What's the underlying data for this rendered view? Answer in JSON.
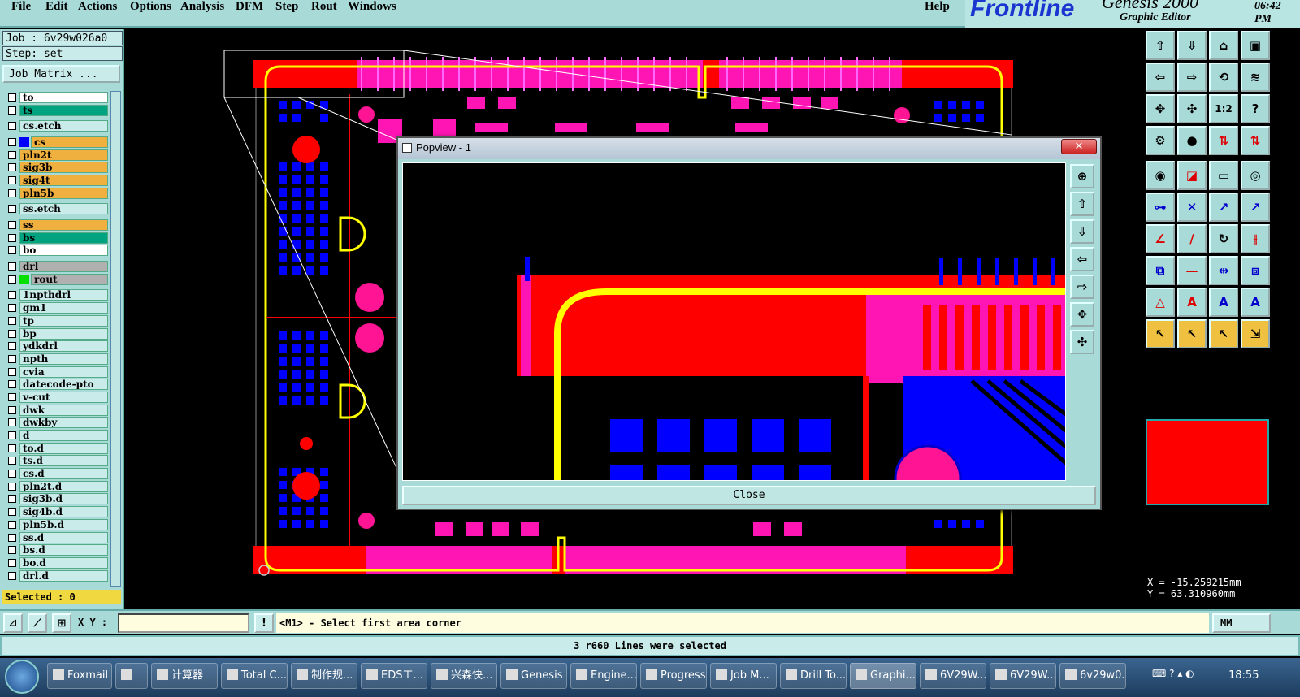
{
  "menubar": {
    "items": [
      "File",
      "Edit",
      "Actions",
      "Options",
      "Analysis",
      "DFM",
      "Step",
      "Rout",
      "Windows"
    ],
    "help": "Help"
  },
  "brand": {
    "logo": "Frontline",
    "product": "Genesis 2000",
    "subtitle": "Graphic Editor",
    "time": "06:42 PM"
  },
  "left": {
    "job": "Job :  6v29w026a0",
    "step": "Step:  set",
    "job_matrix": "Job Matrix ...",
    "layers": [
      {
        "name": "to",
        "color": "#ffffff"
      },
      {
        "name": "ts",
        "color": "#00a37f",
        "active": true
      },
      {
        "gap": true
      },
      {
        "name": "cs.etch",
        "color": "#c9ecea"
      },
      {
        "gap": true
      },
      {
        "name": "cs",
        "color": "#f0b040",
        "swatch": "#0000ff"
      },
      {
        "name": "pln2t",
        "color": "#f0b040"
      },
      {
        "name": "sig3b",
        "color": "#f0b040"
      },
      {
        "name": "sig4t",
        "color": "#f0b040"
      },
      {
        "name": "pln5b",
        "color": "#f0b040"
      },
      {
        "gap": true
      },
      {
        "name": "ss.etch",
        "color": "#c9ecea"
      },
      {
        "gap": true
      },
      {
        "name": "ss",
        "color": "#f0b040"
      },
      {
        "name": "bs",
        "color": "#00a37f"
      },
      {
        "name": "bo",
        "color": "#ffffff"
      },
      {
        "gap": true
      },
      {
        "name": "drl",
        "color": "#b0b0b0"
      },
      {
        "name": "rout",
        "color": "#b0b0b0",
        "swatch": "#00e000"
      },
      {
        "gap": true
      },
      {
        "name": "1npthdrl",
        "color": "#c9ecea"
      },
      {
        "name": "gm1",
        "color": "#c9ecea"
      },
      {
        "name": "tp",
        "color": "#c9ecea"
      },
      {
        "name": "bp",
        "color": "#c9ecea"
      },
      {
        "name": "ydkdrl",
        "color": "#c9ecea"
      },
      {
        "name": "npth",
        "color": "#c9ecea"
      },
      {
        "name": "cvia",
        "color": "#c9ecea"
      },
      {
        "name": "datecode-pto",
        "color": "#c9ecea"
      },
      {
        "name": "v-cut",
        "color": "#c9ecea"
      },
      {
        "name": "dwk",
        "color": "#c9ecea"
      },
      {
        "name": "dwkby",
        "color": "#c9ecea"
      },
      {
        "name": "d",
        "color": "#c9ecea"
      },
      {
        "name": "to.d",
        "color": "#c9ecea"
      },
      {
        "name": "ts.d",
        "color": "#c9ecea"
      },
      {
        "name": "cs.d",
        "color": "#c9ecea"
      },
      {
        "name": "pln2t.d",
        "color": "#c9ecea"
      },
      {
        "name": "sig3b.d",
        "color": "#c9ecea"
      },
      {
        "name": "sig4b.d",
        "color": "#c9ecea"
      },
      {
        "name": "pln5b.d",
        "color": "#c9ecea"
      },
      {
        "name": "ss.d",
        "color": "#c9ecea"
      },
      {
        "name": "bs.d",
        "color": "#c9ecea"
      },
      {
        "name": "bo.d",
        "color": "#c9ecea"
      },
      {
        "name": "drl.d",
        "color": "#c9ecea"
      }
    ],
    "selected": "Selected : 0"
  },
  "popview": {
    "title": "Popview - 1",
    "close_x": "✕",
    "close_button": "Close"
  },
  "right": {
    "coord_x": "X = -15.259215mm",
    "coord_y": "Y =  63.310960mm"
  },
  "cmd": {
    "xy_label": "X Y :",
    "xy_value": "",
    "prompt": "<M1> - Select first area corner",
    "unit": "MM"
  },
  "status": "3 r660 Lines were selected",
  "taskbar": {
    "items": [
      "Foxmail",
      "",
      "计算器",
      "Total C...",
      "制作规...",
      "EDS工...",
      "兴森快...",
      "Genesis",
      "Engine...",
      "Progress",
      "Job M...",
      "Drill To...",
      "Graphi...",
      "6V29W...",
      "6V29W...",
      "6v29w0..."
    ],
    "clock": "18:55"
  }
}
